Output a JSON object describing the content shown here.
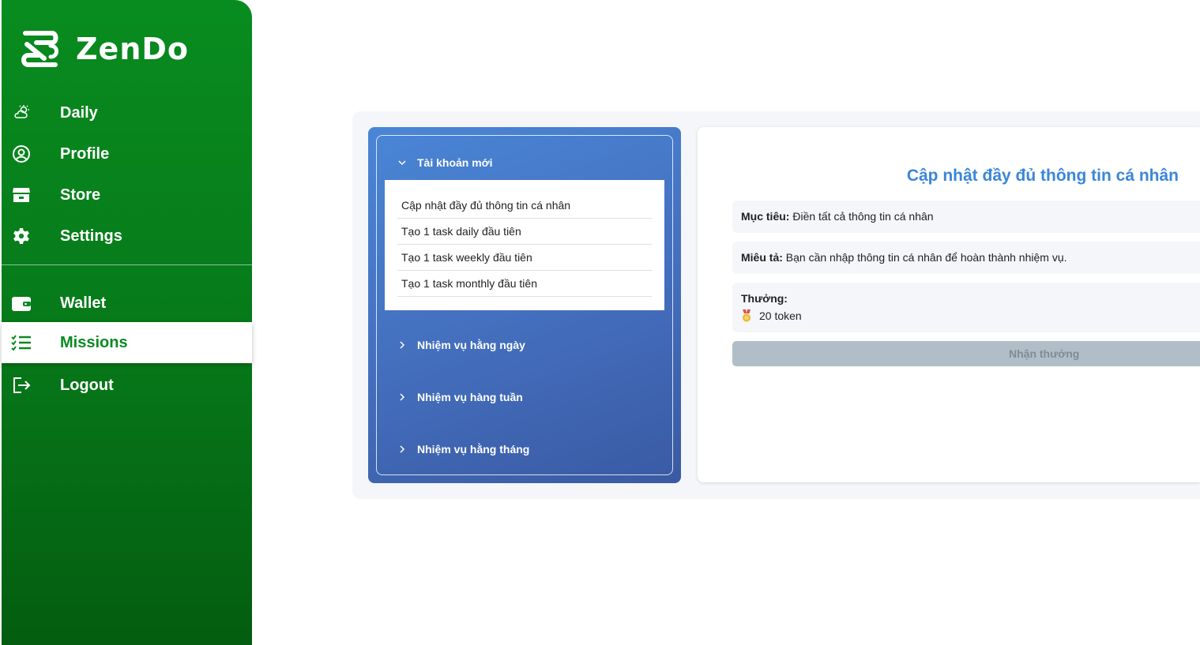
{
  "brand": {
    "name": "ZenDo"
  },
  "sidebar": {
    "items": [
      {
        "label": "Daily",
        "icon": "sun-cloud-icon"
      },
      {
        "label": "Profile",
        "icon": "user-circle-icon"
      },
      {
        "label": "Store",
        "icon": "store-icon"
      },
      {
        "label": "Settings",
        "icon": "gear-icon"
      },
      {
        "label": "Wallet",
        "icon": "wallet-icon"
      },
      {
        "label": "Missions",
        "icon": "checklist-icon",
        "active": true
      },
      {
        "label": "Logout",
        "icon": "logout-icon"
      }
    ]
  },
  "missions": {
    "groups": [
      {
        "title": "Tài khoản mới",
        "expanded": true,
        "items": [
          "Cập nhật đầy đủ thông tin cá nhân",
          "Tạo 1 task daily đầu tiên",
          "Tạo 1 task weekly đầu tiên",
          "Tạo 1 task monthly đầu tiên"
        ]
      },
      {
        "title": "Nhiệm vụ hằng ngày",
        "expanded": false
      },
      {
        "title": "Nhiệm vụ hàng tuần",
        "expanded": false
      },
      {
        "title": "Nhiệm vụ hằng tháng",
        "expanded": false
      }
    ]
  },
  "detail": {
    "title": "Cập nhật đầy đủ thông tin cá nhân",
    "goal_label": "Mục tiêu:",
    "goal_value": "Điền tất cả thông tin cá nhân",
    "desc_label": "Miêu tả:",
    "desc_value": "Bạn cần nhập thông tin cá nhân để hoàn thành nhiệm vụ.",
    "reward_label": "Thưởng:",
    "reward_value": "20 token",
    "reward_icon": "medal-icon",
    "claim_label": "Nhận thưởng"
  },
  "colors": {
    "sidebar": "#088c1f",
    "active_text": "#0a8a22",
    "accent_blue": "#3b86d8",
    "disabled_button": "#b0bec7"
  }
}
